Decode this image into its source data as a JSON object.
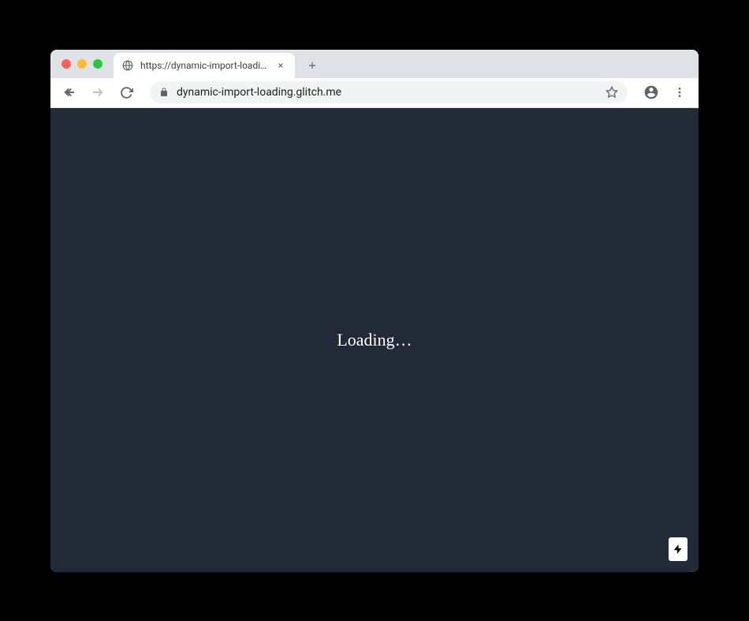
{
  "tab": {
    "title": "https://dynamic-import-loading"
  },
  "addressBar": {
    "url": "dynamic-import-loading.glitch.me"
  },
  "content": {
    "loadingText": "Loading…"
  }
}
